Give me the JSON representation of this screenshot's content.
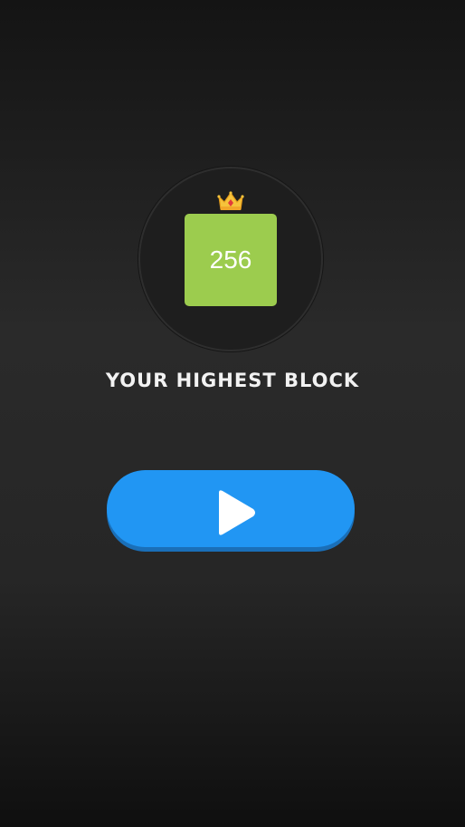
{
  "highest_block": {
    "value": "256",
    "color": "#9ccc4e",
    "crown_icon": "crown-icon"
  },
  "caption": "YOUR HIGHEST BLOCK",
  "play_button": {
    "icon": "play-icon",
    "color": "#2196f3"
  }
}
